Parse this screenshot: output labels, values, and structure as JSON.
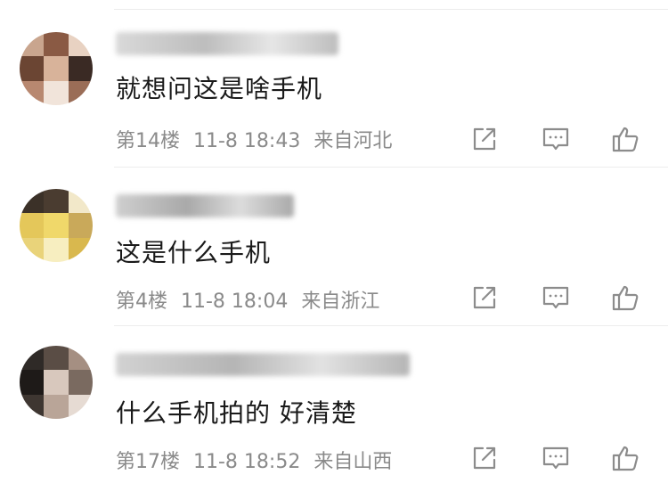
{
  "comments": [
    {
      "text": "就想问这是啥手机",
      "floor": "第14楼",
      "time": "11-8 18:43",
      "location": "来自河北",
      "avatar_colors": [
        "#c9a58e",
        "#8a5a44",
        "#e8d2c2",
        "#6b4533",
        "#d8b39a",
        "#3a2a24",
        "#b88870",
        "#f1e4da",
        "#9a6d57"
      ],
      "username_colors": [
        "#d9d9d9",
        "#bdbdbd",
        "#e6e6e6"
      ]
    },
    {
      "text": "这是什么手机",
      "floor": "第4楼",
      "time": "11-8 18:04",
      "location": "来自浙江",
      "avatar_colors": [
        "#3b3128",
        "#4a3c30",
        "#f2e8c9",
        "#e4c75a",
        "#f0d86a",
        "#c9a95a",
        "#e9d37a",
        "#f7eec0",
        "#d9b84e"
      ],
      "username_colors": [
        "#cfcfcf",
        "#a9a9a9",
        "#dcdcdc"
      ]
    },
    {
      "text": "什么手机拍的 好清楚",
      "floor": "第17楼",
      "time": "11-8 18:52",
      "location": "来自山西",
      "avatar_colors": [
        "#2f2a27",
        "#5a4d45",
        "#a58f82",
        "#1e1a18",
        "#d8c8bd",
        "#7a6a60",
        "#3e3631",
        "#b9a598",
        "#e6dbd3"
      ],
      "username_colors": [
        "#d2d2d2",
        "#b5b5b5",
        "#e2e2e2"
      ]
    }
  ],
  "icons": {
    "share": "share-icon",
    "reply": "comment-icon",
    "like": "like-icon"
  },
  "colors": {
    "meta_text": "#8a8a8a",
    "icon_stroke": "#8c8c8c",
    "divider": "#ececec"
  }
}
